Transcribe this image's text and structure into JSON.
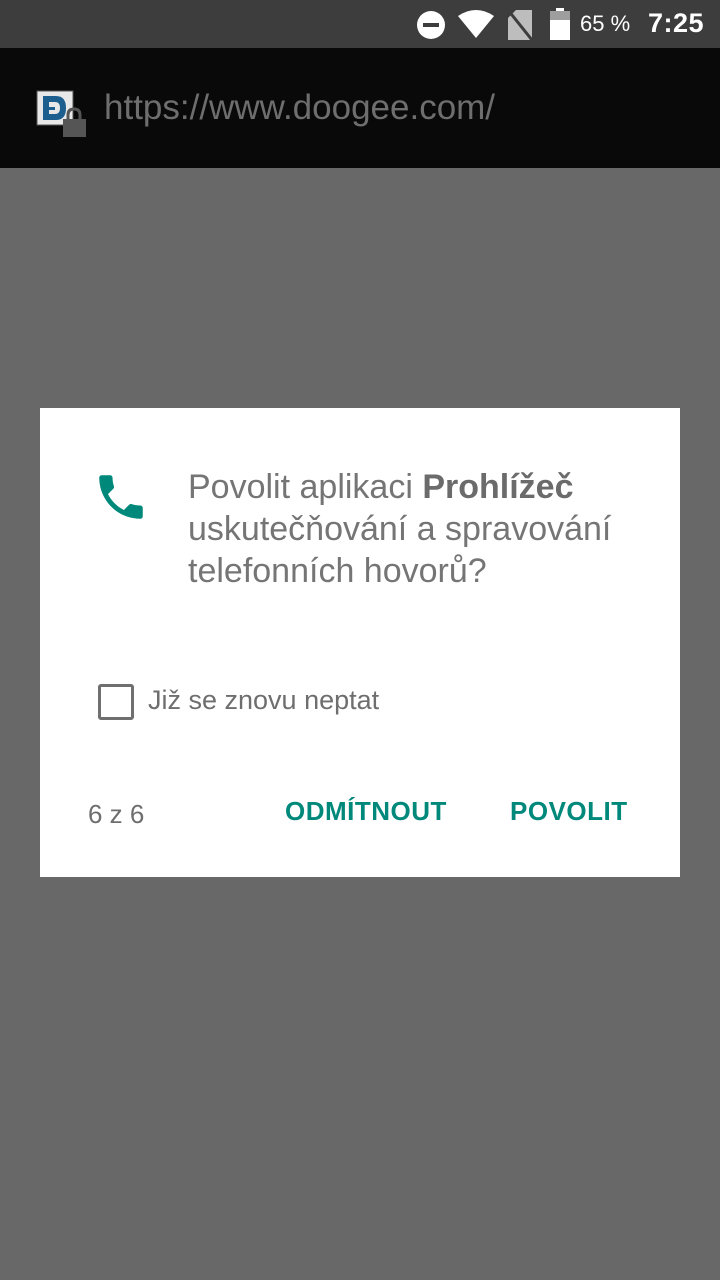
{
  "status_bar": {
    "battery_percent": "65 %",
    "time": "7:25",
    "icons": [
      "do-not-disturb-icon",
      "wifi-icon",
      "no-sim-icon",
      "battery-icon"
    ]
  },
  "browser": {
    "url": "https://www.doogee.com/",
    "site_icon": "doogee-logo-lock-icon"
  },
  "dialog": {
    "icon": "phone-icon",
    "message_prefix": "Povolit aplikaci ",
    "app_name": "Prohlížeč",
    "message_suffix": " uskutečňování a spravování telefonních hovorů?",
    "checkbox_label": "Již se znovu neptat",
    "checkbox_checked": false,
    "page_counter": "6 z 6",
    "deny_label": "ODMÍTNOUT",
    "allow_label": "POVOLIT",
    "accent_color": "#00897b"
  }
}
